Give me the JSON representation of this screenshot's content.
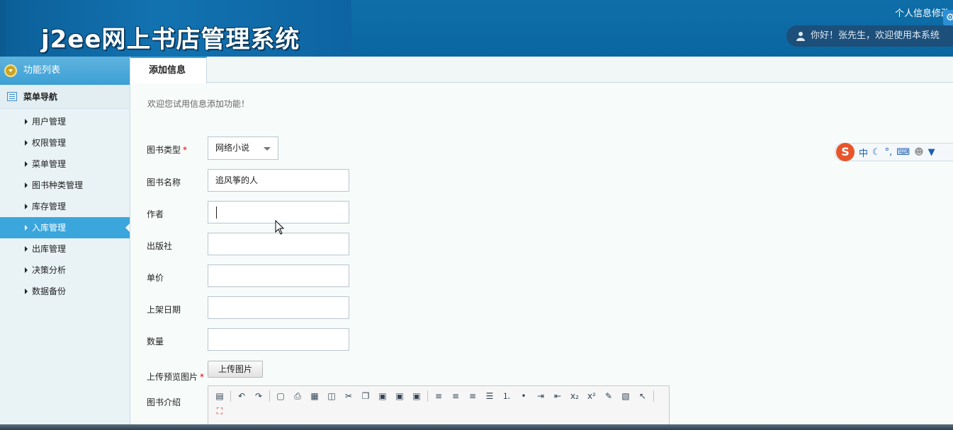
{
  "header": {
    "title": "j2ee网上书店管理系统",
    "top_link": "个人信息修改",
    "welcome": "你好！张先生，欢迎使用本系统"
  },
  "sidebar": {
    "func_list_label": "功能列表",
    "menu_nav_label": "菜单导航",
    "items": [
      {
        "label": "用户管理"
      },
      {
        "label": "权限管理"
      },
      {
        "label": "菜单管理"
      },
      {
        "label": "图书种类管理"
      },
      {
        "label": "库存管理"
      },
      {
        "label": "入库管理"
      },
      {
        "label": "出库管理"
      },
      {
        "label": "决策分析"
      },
      {
        "label": "数据备份"
      }
    ],
    "active_item": "入库管理"
  },
  "main": {
    "tab_label": "添加信息",
    "intro": "欢迎您试用信息添加功能！",
    "form": {
      "book_type_label": "图书类型",
      "book_type_value": "网络小说",
      "book_name_label": "图书名称",
      "book_name_value": "追风筝的人",
      "author_label": "作者",
      "author_value": "",
      "publisher_label": "出版社",
      "publisher_value": "",
      "price_label": "单价",
      "price_value": "",
      "shelf_date_label": "上架日期",
      "shelf_date_value": "",
      "quantity_label": "数量",
      "quantity_value": "",
      "upload_label": "上传预览图片",
      "upload_button": "上传图片",
      "intro_label": "图书介绍",
      "required_mark": "*"
    }
  },
  "ime": {
    "logo": "S",
    "mode": "中"
  },
  "colors": {
    "header_bg": "#0a66a0",
    "active_nav": "#3ba6dc",
    "required": "#dd0000"
  }
}
